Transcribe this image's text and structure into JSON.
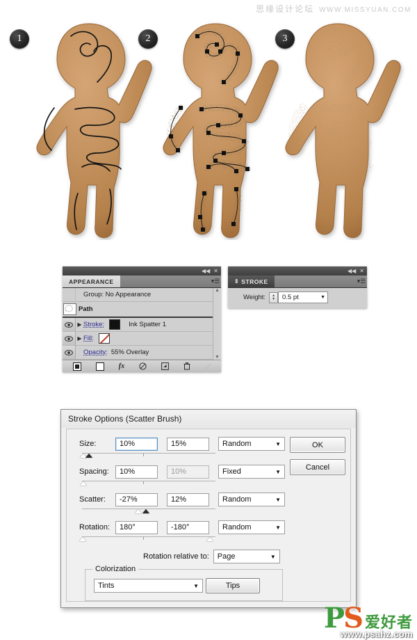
{
  "watermarks": {
    "top_cn": "思缘设计论坛",
    "top_url": "WWW.MISSYUAN.COM",
    "bottom_ps": "P",
    "bottom_ps_s": "S",
    "bottom_cn": "爱好者",
    "bottom_url": "www.psahz.com"
  },
  "steps": [
    {
      "number": "1"
    },
    {
      "number": "2"
    },
    {
      "number": "3"
    }
  ],
  "appearance_panel": {
    "tab_label": "APPEARANCE",
    "collapse_icon": "◀◀",
    "close_icon": "✕",
    "menu_icon": "▾☰",
    "rows": [
      {
        "name": "group-row",
        "label": "Group: No Appearance",
        "type": "group"
      },
      {
        "name": "path-row",
        "label": "Path",
        "type": "path"
      },
      {
        "name": "stroke-row",
        "label": "Stroke:",
        "value": "Ink Spatter 1",
        "type": "stroke"
      },
      {
        "name": "fill-row",
        "label": "Fill:",
        "value": "",
        "type": "fill"
      },
      {
        "name": "opacity-row",
        "label": "Opacity:",
        "value": "55% Overlay",
        "type": "opacity"
      }
    ],
    "footer_icons": [
      "add-new-stroke-icon",
      "add-new-fill-icon",
      "add-new-effect-icon",
      "clear-appearance-icon",
      "duplicate-item-icon",
      "delete-item-icon"
    ],
    "footer_fx_label": "fx",
    "scroll_up": "▲",
    "scroll_down": "▼"
  },
  "stroke_panel": {
    "tab_label": "STROKE",
    "tab_arrows": "⇕",
    "collapse_icon": "◀◀",
    "close_icon": "✕",
    "menu_icon": "▾☰",
    "weight_label": "Weight:",
    "weight_value": "0.5 pt"
  },
  "dialog": {
    "title": "Stroke Options (Scatter Brush)",
    "fields": [
      {
        "name": "size",
        "label": "Size:",
        "value1": "10%",
        "value2": "15%",
        "value2_disabled": false,
        "mode": "Random",
        "focused": true
      },
      {
        "name": "spacing",
        "label": "Spacing:",
        "value1": "10%",
        "value2": "10%",
        "value2_disabled": true,
        "mode": "Fixed",
        "focused": false
      },
      {
        "name": "scatter",
        "label": "Scatter:",
        "value1": "-27%",
        "value2": "12%",
        "value2_disabled": false,
        "mode": "Random",
        "focused": false
      },
      {
        "name": "rotation",
        "label": "Rotation:",
        "value1": "180°",
        "value2": "-180°",
        "value2_disabled": false,
        "mode": "Random",
        "focused": false
      }
    ],
    "rotation_relative_label": "Rotation relative to:",
    "rotation_relative_value": "Page",
    "colorization_title": "Colorization",
    "colorization_method": "Tints",
    "tips_button": "Tips",
    "ok_button": "OK",
    "cancel_button": "Cancel"
  }
}
